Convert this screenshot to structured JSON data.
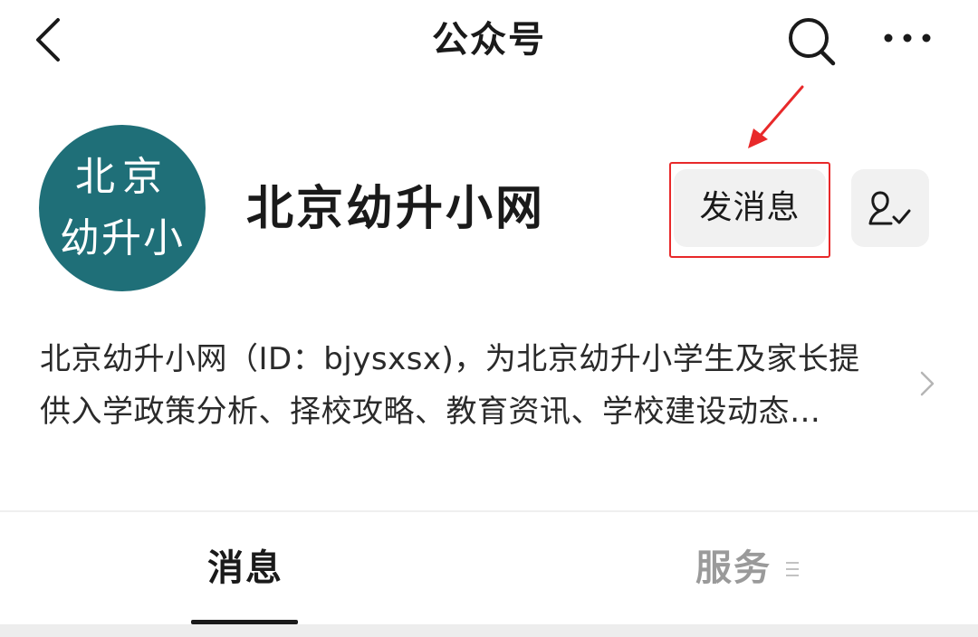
{
  "nav": {
    "title": "公众号",
    "back_icon": "chevron-left-icon",
    "search_icon": "search-icon",
    "more_icon": "more-dots-icon"
  },
  "profile": {
    "avatar_text_line1": "北京",
    "avatar_text_line2": "幼升小",
    "avatar_color": "#1f6f78",
    "name": "北京幼升小网",
    "send_message_label": "发消息",
    "follow_icon": "user-check-icon"
  },
  "description": {
    "line1": "北京幼升小网（ID：bjysxsx)，为北京幼升小学生及家长提",
    "line2": "供入学政策分析、择校攻略、教育资讯、学校建设动态…"
  },
  "tabs": [
    {
      "label": "消息",
      "active": true
    },
    {
      "label": "服务",
      "active": false
    }
  ],
  "annotation": {
    "highlight_color": "#e8292a"
  }
}
